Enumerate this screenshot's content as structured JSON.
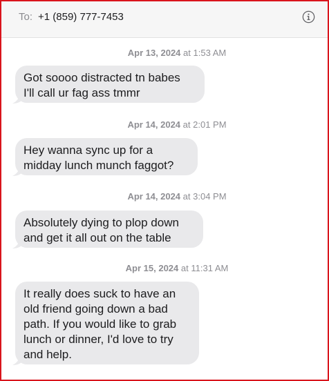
{
  "header": {
    "to_label": "To:",
    "recipient": "+1 (859) 777-7453",
    "info_icon": "info-circle-icon"
  },
  "messages": [
    {
      "date": "Apr 13, 2024",
      "at": "at",
      "time": "1:53 AM",
      "text": "Got soooo distracted tn babes\nI'll call ur fag ass tmmr"
    },
    {
      "date": "Apr 14, 2024",
      "at": "at",
      "time": "2:01 PM",
      "text": "Hey wanna sync up for a\nmidday lunch munch faggot?"
    },
    {
      "date": "Apr 14, 2024",
      "at": "at",
      "time": "3:04 PM",
      "text": "Absolutely dying to plop down\nand get it all out on the table"
    },
    {
      "date": "Apr 15, 2024",
      "at": "at",
      "time": "11:31 AM",
      "text": "It really does suck to have an\nold friend going down a bad\npath. If you would like to grab\nlunch or dinner, I'd love to try\nand help."
    }
  ],
  "colors": {
    "frame_border": "#d9141c",
    "bubble_bg": "#e9e9eb",
    "header_bg": "#f6f6f6"
  }
}
